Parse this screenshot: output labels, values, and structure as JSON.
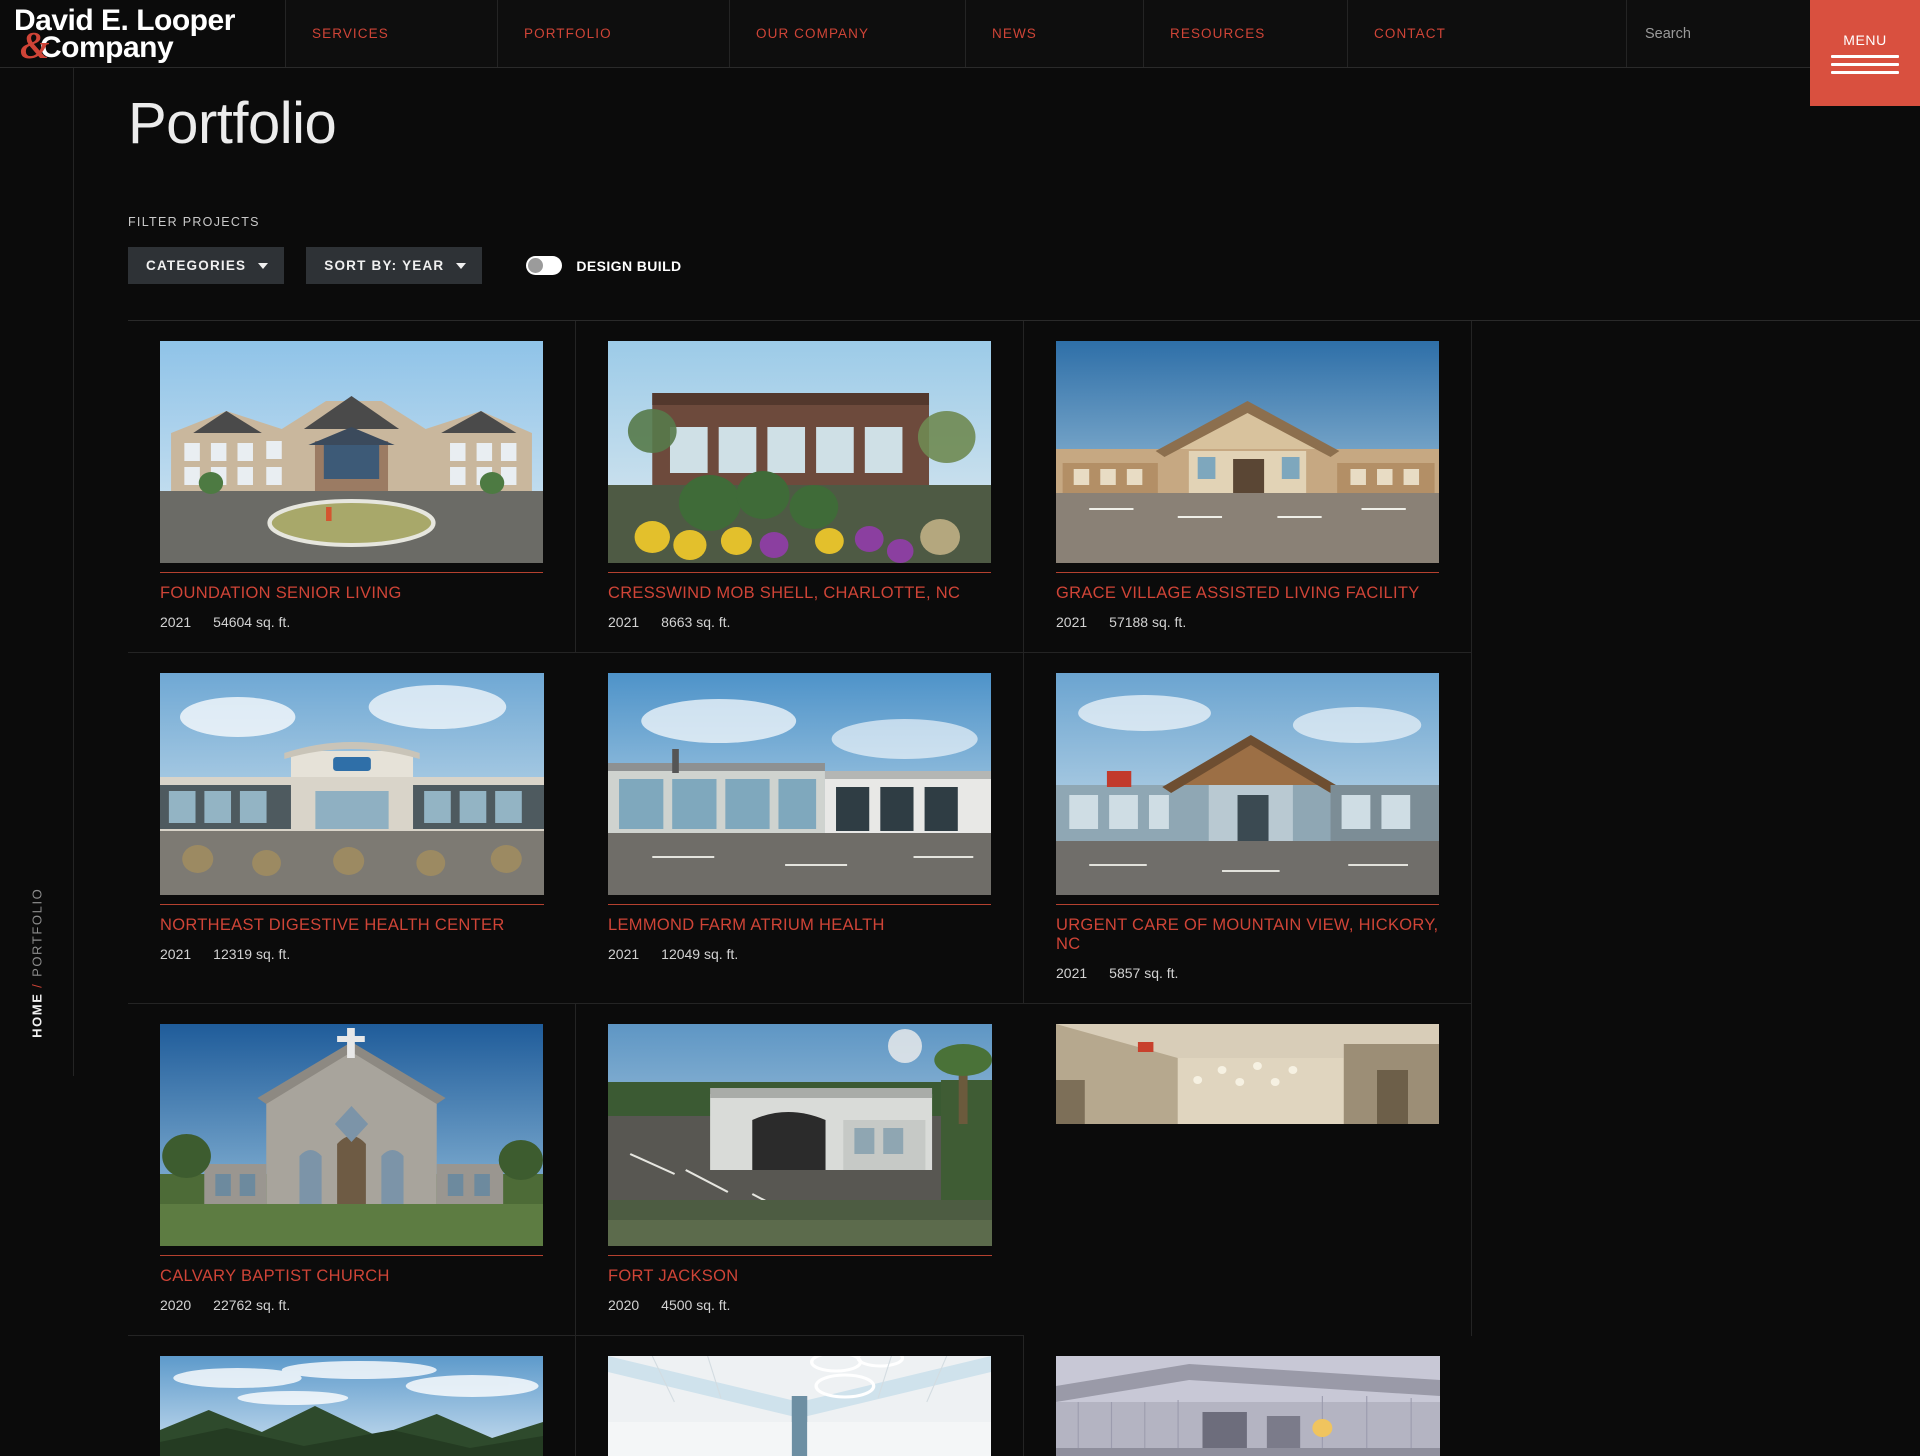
{
  "header": {
    "logo": {
      "line1": "David E. Looper",
      "line2": "Company",
      "ampersand": "&"
    },
    "nav": [
      {
        "label": "SERVICES",
        "name": "services"
      },
      {
        "label": "PORTFOLIO",
        "name": "portfolio"
      },
      {
        "label": "OUR COMPANY",
        "name": "our-company"
      },
      {
        "label": "NEWS",
        "name": "news"
      },
      {
        "label": "RESOURCES",
        "name": "resources"
      },
      {
        "label": "CONTACT",
        "name": "contact"
      }
    ],
    "search": {
      "value": "",
      "placeholder": "Search",
      "icon": "search-icon"
    },
    "menu": {
      "label": "MENU",
      "icon": "hamburger-icon"
    }
  },
  "breadcrumb": {
    "home": "HOME",
    "separator": "/",
    "current": "PORTFOLIO"
  },
  "page": {
    "title": "Portfolio"
  },
  "filters": {
    "label": "FILTER PROJECTS",
    "categories": {
      "label": "CATEGORIES",
      "icon": "chevron-down-icon"
    },
    "sort": {
      "label": "SORT BY: YEAR",
      "icon": "chevron-down-icon"
    },
    "design_build": {
      "label": "DESIGN BUILD",
      "enabled": false
    }
  },
  "colors": {
    "accent": "#cf4437",
    "menu_red": "#d9503f",
    "background": "#0b0b0b",
    "dropdown_bg": "#2e3236",
    "border": "#242424"
  },
  "projects": [
    {
      "title": "FOUNDATION SENIOR LIVING",
      "year": "2021",
      "area": "54604 sq. ft.",
      "image": "apartment-building-exterior"
    },
    {
      "title": "CRESSWIND MOB SHELL, CHARLOTTE, NC",
      "year": "2021",
      "area": "8663 sq. ft.",
      "image": "brick-medical-office-landscaping"
    },
    {
      "title": "GRACE VILLAGE ASSISTED LIVING FACILITY",
      "year": "2021",
      "area": "57188 sq. ft.",
      "image": "assisted-living-portico"
    },
    {
      "title": "NORTHEAST DIGESTIVE HEALTH CENTER",
      "year": "2021",
      "area": "12319 sq. ft.",
      "image": "health-center-exterior"
    },
    {
      "title": "LEMMOND FARM ATRIUM HEALTH",
      "year": "2021",
      "area": "12049 sq. ft.",
      "image": "atrium-health-clinic"
    },
    {
      "title": "URGENT CARE OF MOUNTAIN VIEW, HICKORY, NC",
      "year": "2021",
      "area": "5857 sq. ft.",
      "image": "urgent-care-building"
    },
    {
      "title": "CALVARY BAPTIST CHURCH",
      "year": "2020",
      "area": "22762 sq. ft.",
      "image": "stone-church-with-cross"
    },
    {
      "title": "FORT JACKSON",
      "year": "2020",
      "area": "4500 sq. ft.",
      "image": "metal-building-parking-lot"
    }
  ],
  "projects_partial": [
    {
      "image": "interior-corridor-lobby"
    },
    {
      "image": "mountain-sky-landscape"
    },
    {
      "image": "white-atrium-ceiling-lights"
    },
    {
      "image": "industrial-metal-warehouse"
    }
  ]
}
